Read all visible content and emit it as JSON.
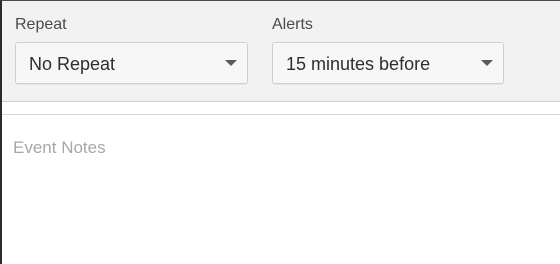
{
  "repeat": {
    "label": "Repeat",
    "value": "No Repeat"
  },
  "alerts": {
    "label": "Alerts",
    "value": "15 minutes before"
  },
  "notes": {
    "placeholder": "Event Notes"
  }
}
